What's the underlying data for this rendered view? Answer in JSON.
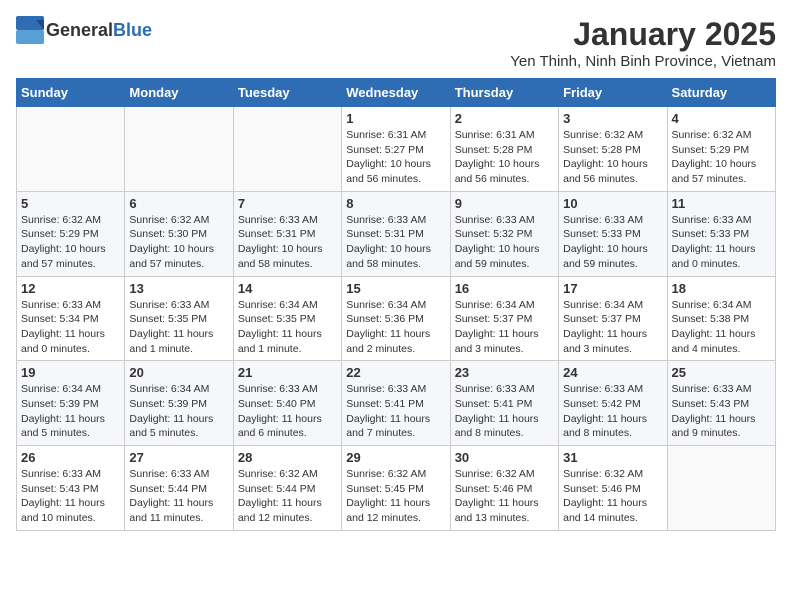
{
  "header": {
    "logo_general": "General",
    "logo_blue": "Blue",
    "month": "January 2025",
    "location": "Yen Thinh, Ninh Binh Province, Vietnam"
  },
  "days_of_week": [
    "Sunday",
    "Monday",
    "Tuesday",
    "Wednesday",
    "Thursday",
    "Friday",
    "Saturday"
  ],
  "weeks": [
    [
      {
        "day": "",
        "info": ""
      },
      {
        "day": "",
        "info": ""
      },
      {
        "day": "",
        "info": ""
      },
      {
        "day": "1",
        "info": "Sunrise: 6:31 AM\nSunset: 5:27 PM\nDaylight: 10 hours and 56 minutes."
      },
      {
        "day": "2",
        "info": "Sunrise: 6:31 AM\nSunset: 5:28 PM\nDaylight: 10 hours and 56 minutes."
      },
      {
        "day": "3",
        "info": "Sunrise: 6:32 AM\nSunset: 5:28 PM\nDaylight: 10 hours and 56 minutes."
      },
      {
        "day": "4",
        "info": "Sunrise: 6:32 AM\nSunset: 5:29 PM\nDaylight: 10 hours and 57 minutes."
      }
    ],
    [
      {
        "day": "5",
        "info": "Sunrise: 6:32 AM\nSunset: 5:29 PM\nDaylight: 10 hours and 57 minutes."
      },
      {
        "day": "6",
        "info": "Sunrise: 6:32 AM\nSunset: 5:30 PM\nDaylight: 10 hours and 57 minutes."
      },
      {
        "day": "7",
        "info": "Sunrise: 6:33 AM\nSunset: 5:31 PM\nDaylight: 10 hours and 58 minutes."
      },
      {
        "day": "8",
        "info": "Sunrise: 6:33 AM\nSunset: 5:31 PM\nDaylight: 10 hours and 58 minutes."
      },
      {
        "day": "9",
        "info": "Sunrise: 6:33 AM\nSunset: 5:32 PM\nDaylight: 10 hours and 59 minutes."
      },
      {
        "day": "10",
        "info": "Sunrise: 6:33 AM\nSunset: 5:33 PM\nDaylight: 10 hours and 59 minutes."
      },
      {
        "day": "11",
        "info": "Sunrise: 6:33 AM\nSunset: 5:33 PM\nDaylight: 11 hours and 0 minutes."
      }
    ],
    [
      {
        "day": "12",
        "info": "Sunrise: 6:33 AM\nSunset: 5:34 PM\nDaylight: 11 hours and 0 minutes."
      },
      {
        "day": "13",
        "info": "Sunrise: 6:33 AM\nSunset: 5:35 PM\nDaylight: 11 hours and 1 minute."
      },
      {
        "day": "14",
        "info": "Sunrise: 6:34 AM\nSunset: 5:35 PM\nDaylight: 11 hours and 1 minute."
      },
      {
        "day": "15",
        "info": "Sunrise: 6:34 AM\nSunset: 5:36 PM\nDaylight: 11 hours and 2 minutes."
      },
      {
        "day": "16",
        "info": "Sunrise: 6:34 AM\nSunset: 5:37 PM\nDaylight: 11 hours and 3 minutes."
      },
      {
        "day": "17",
        "info": "Sunrise: 6:34 AM\nSunset: 5:37 PM\nDaylight: 11 hours and 3 minutes."
      },
      {
        "day": "18",
        "info": "Sunrise: 6:34 AM\nSunset: 5:38 PM\nDaylight: 11 hours and 4 minutes."
      }
    ],
    [
      {
        "day": "19",
        "info": "Sunrise: 6:34 AM\nSunset: 5:39 PM\nDaylight: 11 hours and 5 minutes."
      },
      {
        "day": "20",
        "info": "Sunrise: 6:34 AM\nSunset: 5:39 PM\nDaylight: 11 hours and 5 minutes."
      },
      {
        "day": "21",
        "info": "Sunrise: 6:33 AM\nSunset: 5:40 PM\nDaylight: 11 hours and 6 minutes."
      },
      {
        "day": "22",
        "info": "Sunrise: 6:33 AM\nSunset: 5:41 PM\nDaylight: 11 hours and 7 minutes."
      },
      {
        "day": "23",
        "info": "Sunrise: 6:33 AM\nSunset: 5:41 PM\nDaylight: 11 hours and 8 minutes."
      },
      {
        "day": "24",
        "info": "Sunrise: 6:33 AM\nSunset: 5:42 PM\nDaylight: 11 hours and 8 minutes."
      },
      {
        "day": "25",
        "info": "Sunrise: 6:33 AM\nSunset: 5:43 PM\nDaylight: 11 hours and 9 minutes."
      }
    ],
    [
      {
        "day": "26",
        "info": "Sunrise: 6:33 AM\nSunset: 5:43 PM\nDaylight: 11 hours and 10 minutes."
      },
      {
        "day": "27",
        "info": "Sunrise: 6:33 AM\nSunset: 5:44 PM\nDaylight: 11 hours and 11 minutes."
      },
      {
        "day": "28",
        "info": "Sunrise: 6:32 AM\nSunset: 5:44 PM\nDaylight: 11 hours and 12 minutes."
      },
      {
        "day": "29",
        "info": "Sunrise: 6:32 AM\nSunset: 5:45 PM\nDaylight: 11 hours and 12 minutes."
      },
      {
        "day": "30",
        "info": "Sunrise: 6:32 AM\nSunset: 5:46 PM\nDaylight: 11 hours and 13 minutes."
      },
      {
        "day": "31",
        "info": "Sunrise: 6:32 AM\nSunset: 5:46 PM\nDaylight: 11 hours and 14 minutes."
      },
      {
        "day": "",
        "info": ""
      }
    ]
  ]
}
